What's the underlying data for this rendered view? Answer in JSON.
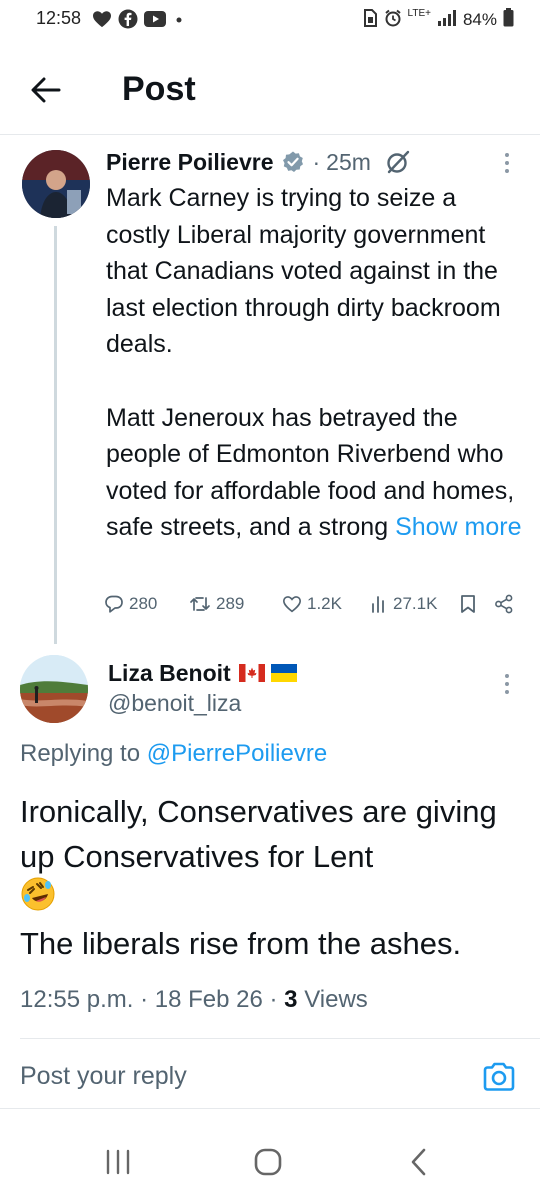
{
  "status_bar": {
    "time": "12:58",
    "network": "LTE+",
    "battery": "84%",
    "left_icons": [
      "heart-icon",
      "facebook-icon",
      "youtube-icon",
      "dot-icon"
    ],
    "right_icons": [
      "sim-icon",
      "alarm-icon",
      "signal-icon",
      "battery-icon"
    ]
  },
  "header": {
    "title": "Post",
    "back_icon": "arrow-left-icon"
  },
  "post": {
    "author": "Pierre Poilievre",
    "time_ago": "25m",
    "separator": "·",
    "verified": true,
    "paragraph1": "Mark Carney is trying to seize a costly Liberal majority government that Canadians voted against in the last election through dirty backroom deals.",
    "paragraph2": "Matt Jeneroux has betrayed the people of Edmonton Riverbend who voted for affordable food and homes, safe streets, and a strong",
    "show_more": "Show more",
    "stats": {
      "replies": "280",
      "reposts": "289",
      "likes": "1.2K",
      "views": "27.1K"
    }
  },
  "reply": {
    "name": "Liza Benoit",
    "handle": "@benoit_liza",
    "flags": [
      "canada-flag-icon",
      "ukraine-flag-icon"
    ],
    "replying_to_label": "Replying to",
    "replying_to_handle": "@PierrePoilievre",
    "line1": "Ironically, Conservatives are giving up Conservatives for Lent",
    "emoji": "rolling-laughing-emoji",
    "line2": "The liberals rise from the ashes.",
    "timestamp": "12:55 p.m.",
    "date": "18 Feb 26",
    "views_count": "3",
    "views_label": "Views"
  },
  "compose": {
    "placeholder": "Post your reply"
  },
  "colors": {
    "accent": "#1d9bf0",
    "text": "#0f1419",
    "muted": "#536471",
    "verified_grey": "#829aab",
    "divider": "#e6e9ec"
  }
}
